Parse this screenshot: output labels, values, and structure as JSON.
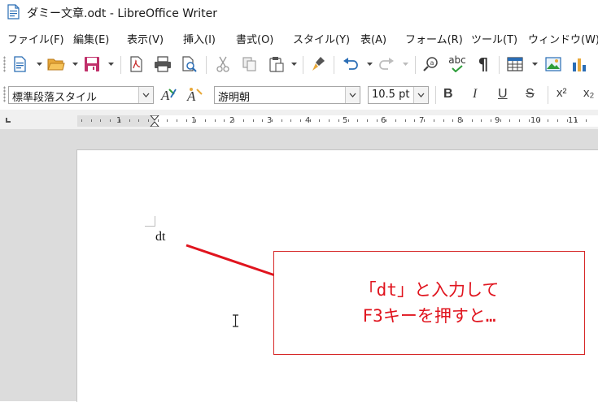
{
  "window": {
    "title": "ダミー文章.odt - LibreOffice Writer"
  },
  "menu": {
    "items": [
      {
        "label": "ファイル(F)"
      },
      {
        "label": "編集(E)"
      },
      {
        "label": "表示(V)"
      },
      {
        "label": "挿入(I)"
      },
      {
        "label": "書式(O)"
      },
      {
        "label": "スタイル(Y)"
      },
      {
        "label": "表(A)"
      },
      {
        "label": "フォーム(R)"
      },
      {
        "label": "ツール(T)"
      },
      {
        "label": "ウィンドウ(W)"
      }
    ]
  },
  "standard_toolbar": {
    "icons": [
      "new-document-icon",
      "open-folder-icon",
      "save-icon",
      "export-pdf-icon",
      "print-icon",
      "print-preview-icon",
      "cut-icon",
      "copy-icon",
      "paste-icon",
      "clone-formatting-icon",
      "undo-icon",
      "redo-icon",
      "find-replace-icon",
      "spellcheck-icon",
      "formatting-marks-icon",
      "insert-table-icon",
      "insert-image-icon",
      "insert-chart-icon"
    ],
    "spellcheck_label": "abc",
    "pilcrow": "¶"
  },
  "formatting_toolbar": {
    "paragraph_style": "標準段落スタイル",
    "font_name": "游明朝",
    "font_size": "10.5 pt",
    "bold": "B",
    "italic": "I",
    "underline": "U",
    "strikethrough": "S",
    "superscript": "x²",
    "subscript": "x₂"
  },
  "ruler": {
    "numbers": [
      "1",
      "1",
      "2",
      "3",
      "4",
      "5",
      "6",
      "7",
      "8",
      "9",
      "10",
      "11"
    ]
  },
  "document": {
    "text": "dt"
  },
  "callout": {
    "line1": "「dt」と入力して",
    "line2": "F3キーを押すと…",
    "color": "#e0141e"
  }
}
